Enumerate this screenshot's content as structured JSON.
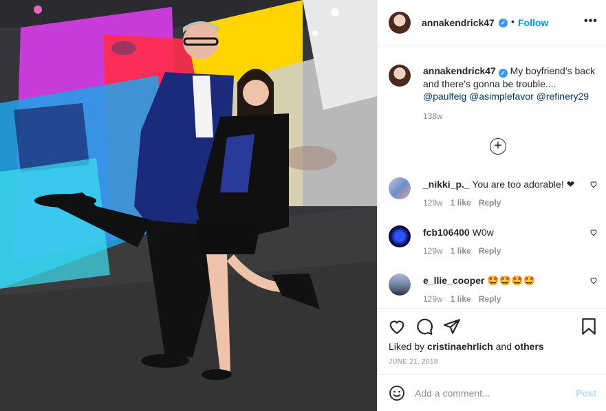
{
  "post": {
    "username": "annakendrick47",
    "follow_label": "Follow",
    "separator": "•",
    "more_label": "•••",
    "caption": {
      "username": "annakendrick47",
      "text": "My boyfriend’s back and there’s gonna be trouble....",
      "mentions": [
        "@paulfeig",
        "@asimplefavor",
        "@refinery29"
      ]
    },
    "time_ago": "138w",
    "load_more_label": "+"
  },
  "comments": [
    {
      "username": "_nikki_p._",
      "text": "You are too adorable! ❤",
      "time": "129w",
      "likes": "1 like",
      "reply": "Reply"
    },
    {
      "username": "fcb106400",
      "text": "W0w",
      "time": "129w",
      "likes": "1 like",
      "reply": "Reply"
    },
    {
      "username": "e_llie_cooper",
      "text": "🤩🤩🤩🤩",
      "time": "129w",
      "likes": "1 like",
      "reply": "Reply"
    }
  ],
  "actions": {
    "liked_by_prefix": "Liked by",
    "liked_by_user": "cristinaehrlich",
    "liked_by_and": "and",
    "liked_by_others": "others",
    "date": "JUNE 21, 2018"
  },
  "add_comment": {
    "placeholder": "Add a comment...",
    "post_label": "Post"
  },
  "icons": [
    "heart-icon",
    "comment-icon",
    "share-icon",
    "bookmark-icon",
    "emoji-icon",
    "verified-badge-icon",
    "plus-circle-icon"
  ],
  "colors": {
    "accent": "#0095f6",
    "verified": "#3897f0",
    "post_disabled": "#b2dffc",
    "muted": "#8e8e8e"
  }
}
